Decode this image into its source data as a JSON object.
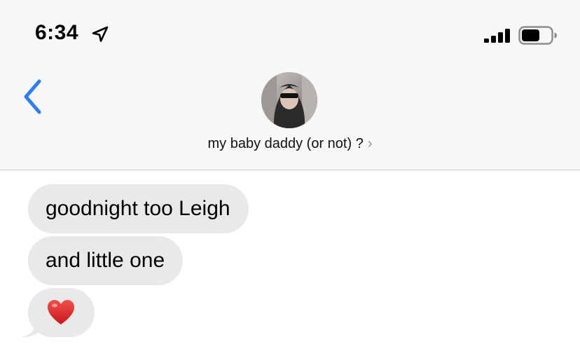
{
  "status_bar": {
    "time": "6:34",
    "icons": [
      "location-arrow-icon",
      "cellular-signal-icon",
      "battery-icon"
    ]
  },
  "nav": {
    "back_icon": "chevron-left-icon",
    "contact_name": "my baby daddy (or not) ?",
    "contact_chevron": "›",
    "avatar": "contact-avatar-photo"
  },
  "messages": [
    {
      "direction": "received",
      "text": "goodnight too Leigh"
    },
    {
      "direction": "received",
      "text": "and little one"
    },
    {
      "direction": "received",
      "text": "❤️",
      "icon": "red-heart-emoji"
    }
  ],
  "colors": {
    "accent": "#2f7cf6",
    "header_bg": "#f7f7f7",
    "received_bubble": "#e9e9eb",
    "text": "#000000"
  }
}
